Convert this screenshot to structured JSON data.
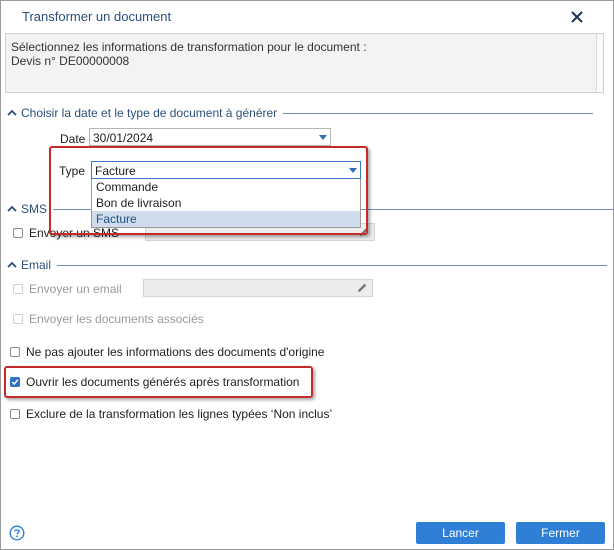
{
  "dialog": {
    "title": "Transformer un document",
    "close_icon": "close-icon"
  },
  "info": {
    "line1": "Sélectionnez les informations de transformation pour le document :",
    "line2": "Devis n° DE00000008"
  },
  "sections": {
    "date_type": "Choisir la date et le type de document à générer",
    "sms": "SMS",
    "email": "Email"
  },
  "fields": {
    "date_label": "Date",
    "date_value": "30/01/2024",
    "type_label": "Type",
    "type_value": "Facture",
    "type_options": [
      "Commande",
      "Bon de livraison",
      "Facture"
    ],
    "type_selected_index": 2
  },
  "sms": {
    "send_label": "Envoyer un SMS"
  },
  "email": {
    "send_label": "Envoyer un email",
    "attach_label": "Envoyer les documents associés"
  },
  "options": {
    "no_origin_info": {
      "label": "Ne pas ajouter les informations des documents d'origine",
      "checked": false
    },
    "open_generated": {
      "label": "Ouvrir les documents générés après transformation",
      "checked": true
    },
    "exclude_lines": {
      "label": "Exclure de la transformation les lignes typées ‘Non inclus’",
      "checked": false
    }
  },
  "buttons": {
    "cancel": "Lancer",
    "close": "Fermer"
  },
  "colors": {
    "accent": "#2f7fd7",
    "section_text": "#2b4f7a",
    "highlight_border": "#c42a2a"
  }
}
